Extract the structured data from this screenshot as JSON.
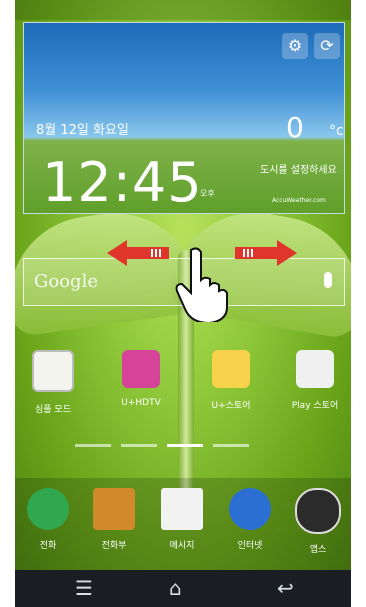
{
  "weather_widget": {
    "date": "8월 12일 화요일",
    "time": "12:45",
    "ampm": "오후",
    "temperature": "0",
    "unit": "°c",
    "message": "도시를 설정하세요",
    "source": "AccuWeather.com",
    "settings_icon": "gear-icon",
    "refresh_icon": "refresh-icon"
  },
  "search": {
    "logo": "Google"
  },
  "apps": [
    {
      "label": "심플 모드"
    },
    {
      "label": "U+HDTV"
    },
    {
      "label": "U+스토어"
    },
    {
      "label": "Play 스토어"
    }
  ],
  "dock": [
    {
      "label": "전화"
    },
    {
      "label": "전화부"
    },
    {
      "label": "메시지"
    },
    {
      "label": "인터넷"
    },
    {
      "label": "앱스"
    }
  ],
  "colors": {
    "arrow": "#e0352b",
    "wallpaper": "#8fc83a"
  }
}
